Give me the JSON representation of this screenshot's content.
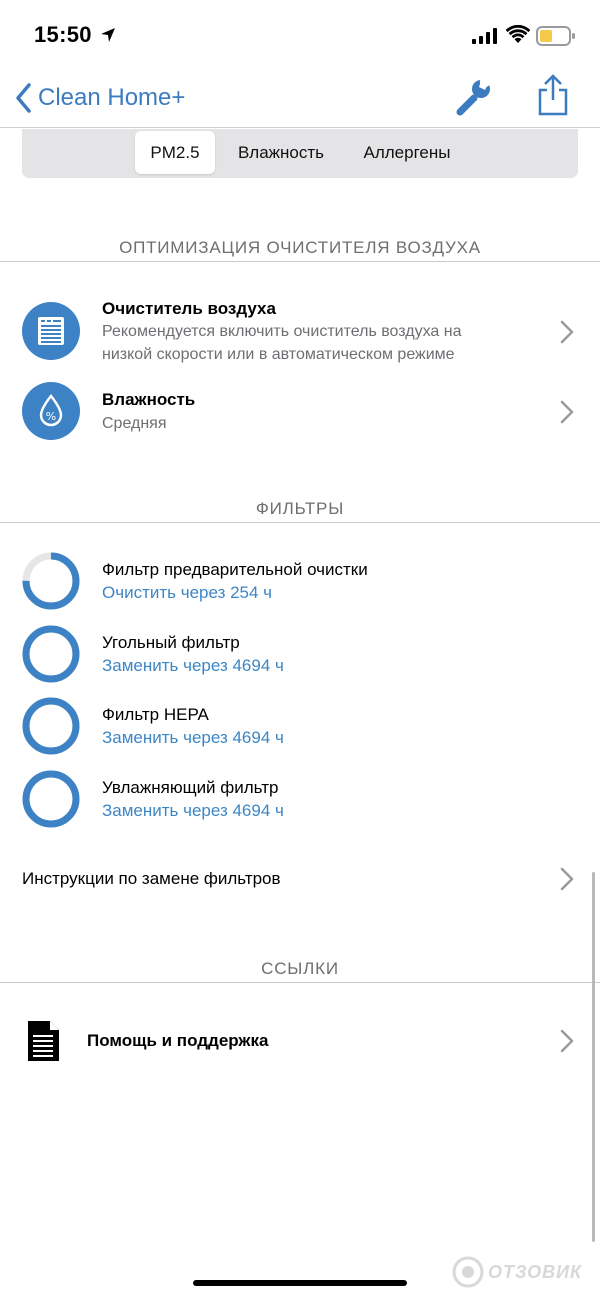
{
  "status": {
    "time": "15:50",
    "battery_color": "#f6c94a"
  },
  "nav": {
    "back_label": "Clean Home+",
    "icons": [
      "chevron-left-icon",
      "wrench-icon",
      "share-icon"
    ],
    "accent": "#3c7bbf"
  },
  "tabs": [
    {
      "label": "PM2.5",
      "active": true
    },
    {
      "label": "Влажность",
      "active": false
    },
    {
      "label": "Аллергены",
      "active": false
    }
  ],
  "optimization": {
    "header": "ОПТИМИЗАЦИЯ ОЧИСТИТЕЛЯ ВОЗДУХА",
    "items": [
      {
        "title": "Очиститель воздуха",
        "subtitle_line1": "Рекомендуется включить очиститель воздуха на",
        "subtitle_line2": "низкой скорости или в автоматическом режиме",
        "icon": "air-purifier-icon"
      },
      {
        "title": "Влажность",
        "subtitle": "Средняя",
        "icon": "humidity-drop-icon"
      }
    ]
  },
  "filters": {
    "header": "ФИЛЬТРЫ",
    "items": [
      {
        "name": "Фильтр предварительной очистки",
        "status": "Очистить через 254 ч",
        "remaining": 0.75
      },
      {
        "name": "Угольный фильтр",
        "status": "Заменить через 4694 ч",
        "remaining": 1.0
      },
      {
        "name": "Фильтр HEPA",
        "status": "Заменить через 4694 ч",
        "remaining": 1.0
      },
      {
        "name": "Увлажняющий фильтр",
        "status": "Заменить через 4694 ч",
        "remaining": 1.0
      }
    ],
    "instructions_label": "Инструкции по замене фильтров",
    "ring_color": "#3d82c4"
  },
  "links": {
    "header": "ССЫЛКИ",
    "help_label": "Помощь и поддержка",
    "help_icon": "document-icon"
  },
  "watermark": "ОТЗОВИК"
}
